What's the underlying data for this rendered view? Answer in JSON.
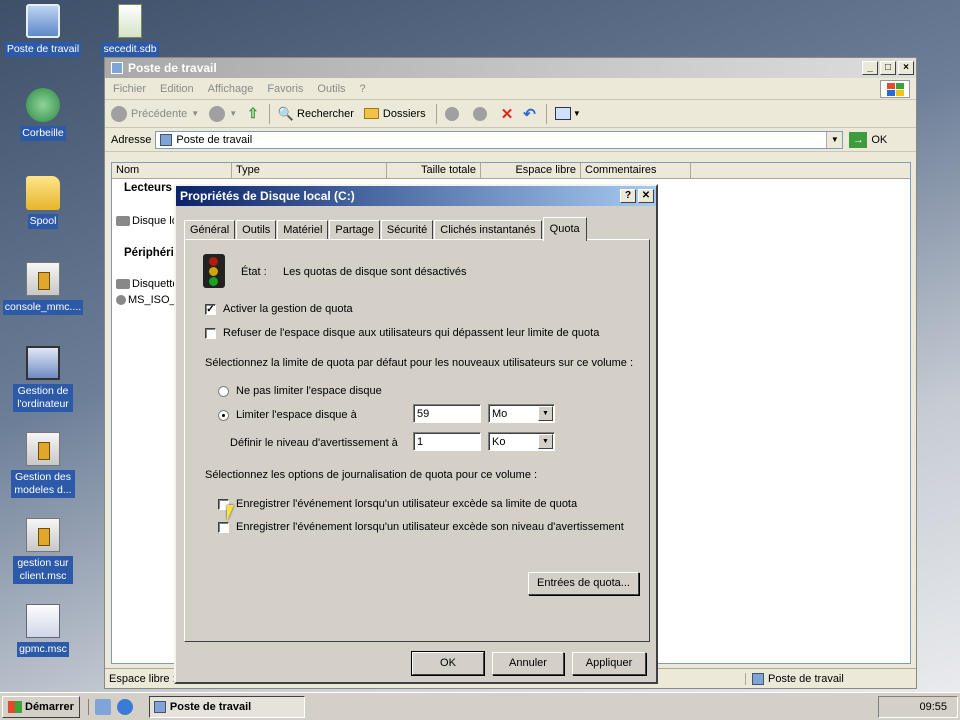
{
  "desktop": {
    "icons": [
      {
        "label": "Poste de travail",
        "icon": "computer-icon"
      },
      {
        "label": "secedit.sdb",
        "icon": "sdb-file-icon"
      },
      {
        "label": "Corbeille",
        "icon": "recycle-bin-icon"
      },
      {
        "label": "Spool",
        "icon": "folder-icon"
      },
      {
        "label": "console_mmc....",
        "icon": "mmc-console-icon"
      },
      {
        "label": "Gestion de l'ordinateur",
        "icon": "computer-management-icon"
      },
      {
        "label": "Gestion des modeles d...",
        "icon": "mmc-console-icon"
      },
      {
        "label": "gestion sur client.msc",
        "icon": "mmc-console-icon"
      },
      {
        "label": "gpmc.msc",
        "icon": "gpmc-icon"
      }
    ]
  },
  "explorer": {
    "title": "Poste de travail",
    "menu": [
      "Fichier",
      "Edition",
      "Affichage",
      "Favoris",
      "Outils",
      "?"
    ],
    "toolbar": {
      "back": "Précédente",
      "search": "Rechercher",
      "folders": "Dossiers"
    },
    "address": {
      "label": "Adresse",
      "value": "Poste de travail",
      "go": "OK"
    },
    "columns": [
      "Nom",
      "Type",
      "Taille totale",
      "Espace libre",
      "Commentaires"
    ],
    "groups": {
      "drives": "Lecteurs",
      "devices": "Périphéri"
    },
    "items": {
      "local_disk": "Disque lo",
      "floppy": "Disquette",
      "iso": "MS_ISO_"
    },
    "status": {
      "left": "Espace libre :",
      "right": "Poste de travail"
    }
  },
  "dialog": {
    "title": "Propriétés de Disque local (C:)",
    "help_btn": "?",
    "close_btn": "✕",
    "tabs": [
      "Général",
      "Outils",
      "Matériel",
      "Partage",
      "Sécurité",
      "Clichés instantanés",
      "Quota"
    ],
    "active_tab": "Quota",
    "status_label": "État :",
    "status_value": "Les quotas de disque sont désactivés",
    "enable_quota": {
      "label": "Activer la gestion de quota",
      "checked": true
    },
    "deny_space": {
      "label": "Refuser de l'espace disque aux utilisateurs qui dépassent leur limite de quota",
      "checked": false
    },
    "default_limit_heading": "Sélectionnez la limite de quota par défaut pour les nouveaux utilisateurs sur ce volume :",
    "no_limit": {
      "label": "Ne pas limiter l'espace disque",
      "selected": false
    },
    "limit": {
      "label": "Limiter l'espace disque à",
      "selected": true,
      "value": "59",
      "unit": "Mo"
    },
    "warning": {
      "label": "Définir le niveau d'avertissement à",
      "value": "1",
      "unit": "Ko"
    },
    "logging_heading": "Sélectionnez les options de journalisation de quota pour ce volume :",
    "log_limit": {
      "label": "Enregistrer l'événement lorsqu'un utilisateur excède sa limite de quota",
      "checked": false
    },
    "log_warning": {
      "label": "Enregistrer l'événement lorsqu'un utilisateur excède son niveau d'avertissement",
      "checked": false
    },
    "entries_button": "Entrées de quota...",
    "ok": "OK",
    "cancel": "Annuler",
    "apply": "Appliquer"
  },
  "taskbar": {
    "start": "Démarrer",
    "task": "Poste de travail",
    "clock": "09:55"
  }
}
